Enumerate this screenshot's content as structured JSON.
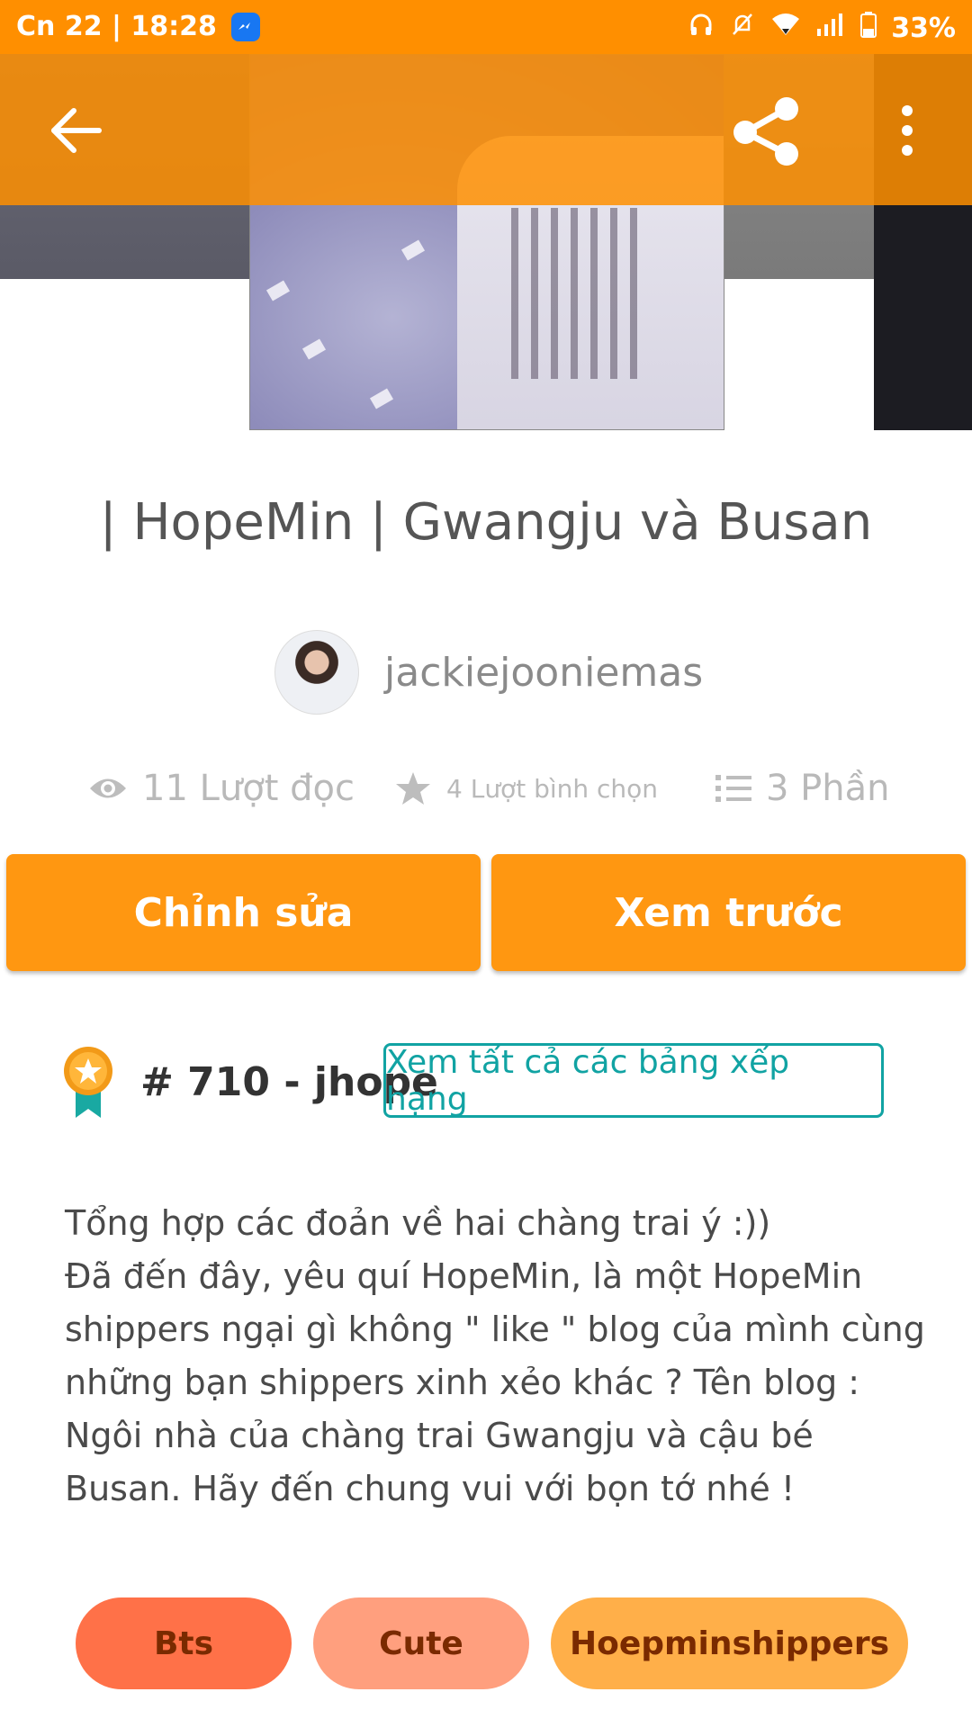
{
  "status_bar": {
    "time": "Cn 22 | 18:28",
    "battery": "33%",
    "icons": [
      "messenger-icon",
      "headphones-icon",
      "bell-off-icon",
      "wifi-icon",
      "signal-icon",
      "battery-icon"
    ]
  },
  "toolbar": {
    "icons": [
      "back-arrow-icon",
      "share-icon",
      "more-vert-icon"
    ]
  },
  "story": {
    "title": "| HopeMin | Gwangju và Busan",
    "author": "jackiejooniemas"
  },
  "stats": {
    "reads": "11 Lượt đọc",
    "votes": "4 Lượt bình chọn",
    "parts": "3 Phần"
  },
  "actions": {
    "edit": "Chỉnh sửa",
    "preview": "Xem trước"
  },
  "ranking": {
    "rank": "# 710 - jhope",
    "view_all": "Xem tất cả các bảng xếp hạng"
  },
  "description": {
    "line1": "Tổng hợp các đoản về hai chàng trai ý :))",
    "line2": "Đã đến đây, yêu quí HopeMin, là một HopeMin shippers ngại gì không \" like \" blog của mình cùng những bạn shippers xinh xẻo khác ? Tên blog : Ngôi nhà của chàng trai Gwangju và cậu bé Busan. Hãy đến chung vui với bọn tớ nhé !"
  },
  "tags": [
    "Bts",
    "Cute",
    "Hoepminshippers"
  ],
  "colors": {
    "brand_orange": "#ff8f00",
    "button_orange": "#ff9711",
    "teal": "#11a3a3",
    "tag_colors": [
      "#ff7148",
      "#ff9f7e",
      "#ffaf49"
    ]
  }
}
